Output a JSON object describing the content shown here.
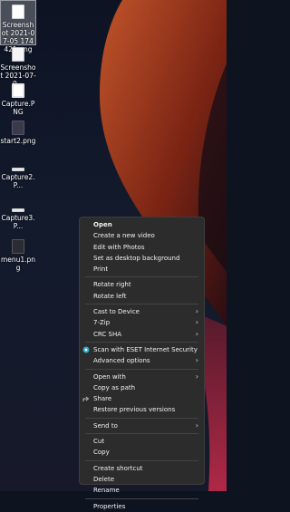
{
  "desktop_icons": [
    {
      "label": "Screenshot 2021-07-05 174421.png",
      "selected": true
    },
    {
      "label": "Screenshot 2021-07-0..."
    },
    {
      "label": "Capture.PNG"
    },
    {
      "label": "start2.png"
    },
    {
      "label": "Capture2.P..."
    },
    {
      "label": "Capture3.P..."
    },
    {
      "label": "menu1.png"
    }
  ],
  "menu": {
    "open": "Open",
    "create_video": "Create a new video",
    "edit_photos": "Edit with Photos",
    "set_background": "Set as desktop background",
    "print": "Print",
    "rotate_right": "Rotate right",
    "rotate_left": "Rotate left",
    "cast": "Cast to Device",
    "zip": "7-Zip",
    "crc": "CRC SHA",
    "eset": "Scan with ESET Internet Security",
    "advanced": "Advanced options",
    "open_with": "Open with",
    "copy_path": "Copy as path",
    "share": "Share",
    "restore": "Restore previous versions",
    "send_to": "Send to",
    "cut": "Cut",
    "copy": "Copy",
    "create_shortcut": "Create shortcut",
    "delete": "Delete",
    "rename": "Rename",
    "properties": "Properties",
    "arrow": "›"
  },
  "colors": {
    "menu_bg": "#2c2c2c",
    "accent_wallpaper": "#b6451f"
  }
}
